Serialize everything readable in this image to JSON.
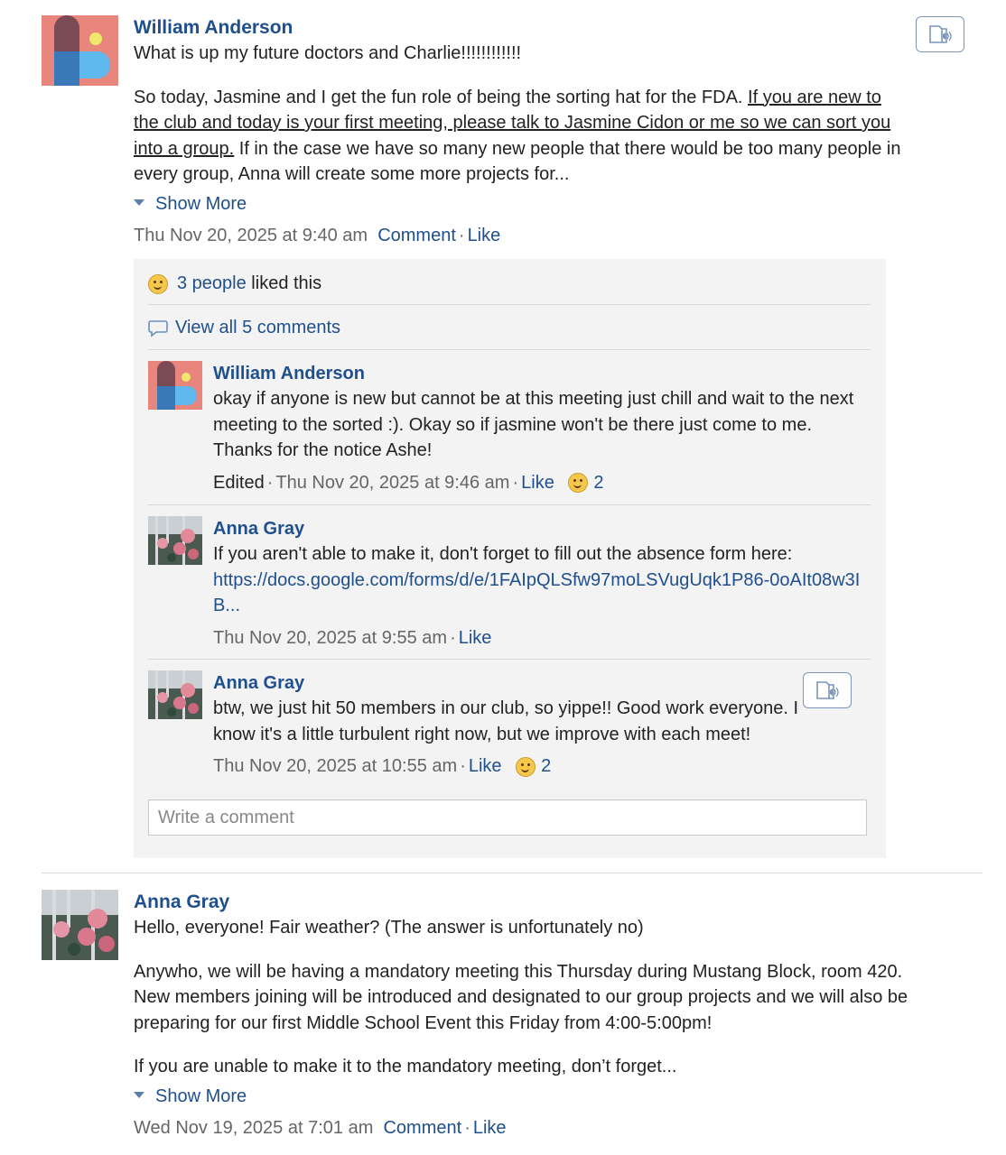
{
  "post1": {
    "author": "William Anderson",
    "greeting": "What is up my future doctors and Charlie!!!!!!!!!!!!",
    "para_lead": "So today, Jasmine and I get the fun role of being the sorting hat for the FDA. ",
    "para_underlined": "If you are new to the club and today is your first meeting, please talk to Jasmine Cidon or me so we can sort you into a group.",
    "para_tail": " If in the case we have so many new people that there would be too many people in every group, Anna will create some more projects for...",
    "show_more": "Show More",
    "timestamp": "Thu Nov 20, 2025 at 9:40 am",
    "comment_label": "Comment",
    "like_label": "Like",
    "likes_count_link": "3 people",
    "likes_suffix": " liked this",
    "view_comments": "View all 5 comments",
    "write_placeholder": "Write a comment",
    "comments": [
      {
        "author": "William Anderson",
        "text": "okay if anyone is new but cannot be at this meeting just chill and wait to the next meeting to the sorted :). Okay so if jasmine won't be there just come to me. Thanks for the notice Ashe!",
        "edited": "Edited",
        "timestamp": "Thu Nov 20, 2025 at 9:46 am",
        "like_label": "Like",
        "reactions": "2"
      },
      {
        "author": "Anna Gray",
        "text": "If you aren't able to make it, don't forget to fill out the absence form here:",
        "link": "https://docs.google.com/forms/d/e/1FAIpQLSfw97moLSVugUqk1P86-0oAIt08w3IB...",
        "timestamp": "Thu Nov 20, 2025 at 9:55 am",
        "like_label": "Like"
      },
      {
        "author": "Anna Gray",
        "text": "btw, we just hit 50 members in our club, so yippe!! Good work everyone. I know it's a little turbulent right now, but we improve with each meet!",
        "timestamp": "Thu Nov 20, 2025 at 10:55 am",
        "like_label": "Like",
        "reactions": "2"
      }
    ]
  },
  "post2": {
    "author": "Anna Gray",
    "greeting": "Hello, everyone! Fair weather? (The answer is unfortunately no)",
    "para1": "Anywho, we will be having a mandatory meeting this Thursday during Mustang Block, room 420. New members joining will be introduced and designated to our group projects and we will also be preparing for our first Middle School Event this Friday from 4:00-5:00pm!",
    "para2": "If you are unable to make it to the mandatory meeting, don’t forget...",
    "show_more": "Show More",
    "timestamp": "Wed Nov 19, 2025 at 7:01 am",
    "comment_label": "Comment",
    "like_label": "Like"
  },
  "icons": {
    "readspeaker": "read-aloud-icon",
    "smiley": "smiley-reaction-icon",
    "comment_bubble": "comment-bubble-icon",
    "expand": "triangle-down-icon"
  },
  "colors": {
    "link": "#1f4f8c",
    "meta": "#666666",
    "comment_bg": "#f3f3f3"
  }
}
